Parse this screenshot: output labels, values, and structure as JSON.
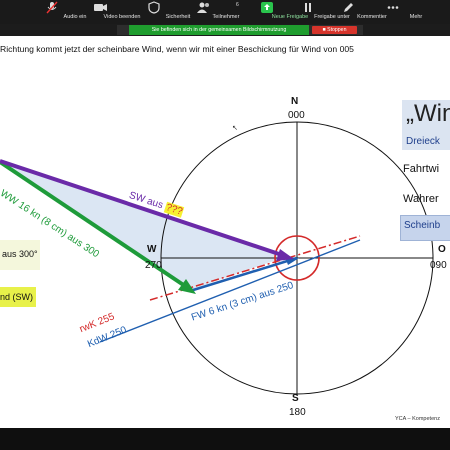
{
  "toolbar": {
    "items": [
      {
        "label": "Audio ein",
        "icon": "mic-muted-icon"
      },
      {
        "label": "Video beenden",
        "icon": "video-camera-icon"
      },
      {
        "label": "Sicherheit",
        "icon": "shield-icon"
      },
      {
        "label": "Teilnehmer",
        "icon": "participants-icon",
        "badge": "6"
      },
      {
        "label": "Neue Freigabe",
        "icon": "share-screen-icon"
      },
      {
        "label": "Freigabe unter",
        "icon": "pause-icon"
      },
      {
        "label": "Kommentier",
        "icon": "annotate-pen-icon"
      },
      {
        "label": "Mehr",
        "icon": "more-icon"
      }
    ]
  },
  "share_banner": {
    "text": "Sie befinden sich in der gemeinsamen Bildschirmnutzung",
    "stop_label": "Stoppen"
  },
  "slide": {
    "title": "Richtung kommt jetzt der scheinbare Wind, wenn wir mit einer Beschickung für Wind von 005",
    "compass": {
      "n_letter": "N",
      "n_value": "000",
      "w_letter": "W",
      "w_value": "270",
      "s_letter": "S",
      "s_value": "180",
      "e_letter": "O",
      "e_value": "090"
    },
    "vectors": {
      "sw": "SW aus",
      "sw_q": "???",
      "ww": "WW 16 kn (8 cm) aus 300",
      "fw": "FW 6 kn (3 cm) aus 250",
      "rwk": "rwK 255",
      "kdw": "KdW 250"
    },
    "left_box1": "aus 300°",
    "left_box2": "nd (SW)",
    "right_panel": {
      "title": "„Win",
      "subtitle": "Dreieck",
      "line1": "Fahrtwi",
      "line2": "Wahrer",
      "line3": "Scheinb"
    },
    "footer": "YCA – Kompetenz"
  },
  "colors": {
    "sw_arrow": "#6a2aa8",
    "ww_arrow": "#1e9b3a",
    "fw_arrow": "#1f5fb0",
    "rwk_line": "#d42a2a",
    "triangle_fill": "#dbe6f3",
    "banner": "#1f9d2e",
    "stop": "#d6342b"
  }
}
